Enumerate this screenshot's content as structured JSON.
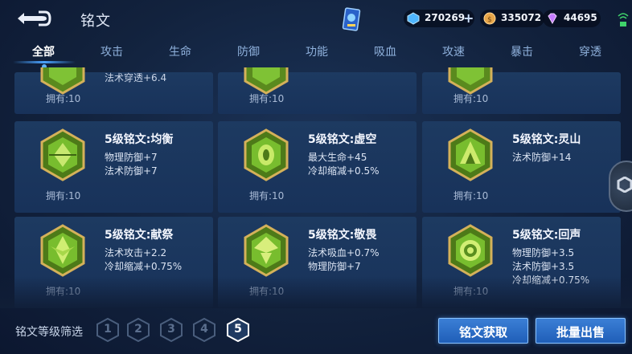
{
  "header": {
    "title": "铭文",
    "currencies": [
      {
        "icon": "diamond-icon",
        "value": "270269"
      },
      {
        "icon": "gold-coin-icon",
        "value": "335072"
      },
      {
        "icon": "gem-icon",
        "value": "44695"
      }
    ]
  },
  "tabs": [
    "全部",
    "攻击",
    "生命",
    "防御",
    "功能",
    "吸血",
    "攻速",
    "暴击",
    "穿透"
  ],
  "active_tab": "全部",
  "partial_row": [
    {
      "desc": "法术穿透+6.4",
      "owned": "拥有:10"
    },
    {
      "desc": "",
      "owned": "拥有:10"
    },
    {
      "desc": "",
      "owned": "拥有:10"
    }
  ],
  "cards": [
    {
      "title": "5级铭文:均衡",
      "stats": [
        "物理防御+7",
        "法术防御+7"
      ],
      "owned": "拥有:10"
    },
    {
      "title": "5级铭文:虚空",
      "stats": [
        "最大生命+45",
        "冷却缩减+0.5%"
      ],
      "owned": "拥有:10"
    },
    {
      "title": "5级铭文:灵山",
      "stats": [
        "法术防御+14"
      ],
      "owned": "拥有:10"
    },
    {
      "title": "5级铭文:献祭",
      "stats": [
        "法术攻击+2.2",
        "冷却缩减+0.75%"
      ],
      "owned": "拥有:10"
    },
    {
      "title": "5级铭文:敬畏",
      "stats": [
        "法术吸血+0.7%",
        "物理防御+7"
      ],
      "owned": "拥有:10"
    },
    {
      "title": "5级铭文:回声",
      "stats": [
        "物理防御+3.5",
        "法术防御+3.5",
        "冷却缩减+0.75%"
      ],
      "owned": "拥有:10"
    }
  ],
  "footer": {
    "filter_label": "铭文等级筛选",
    "levels": [
      "1",
      "2",
      "3",
      "4",
      "5"
    ],
    "active_level": "5",
    "get_button": "铭文获取",
    "sell_button": "批量出售"
  },
  "colors": {
    "accent": "#4aa3ff",
    "card_bg": "#1d3a61",
    "medal_gold": "#c9a84a",
    "medal_green": "#6fbf2c"
  }
}
